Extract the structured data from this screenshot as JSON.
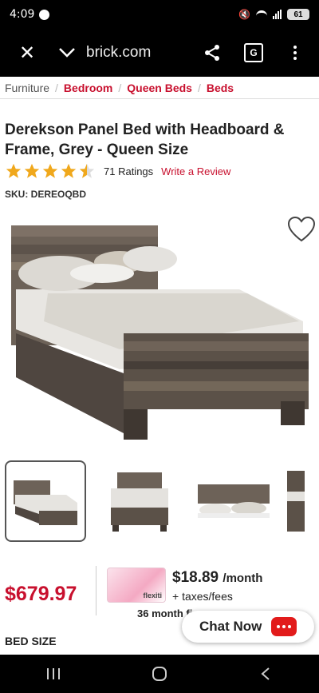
{
  "status_bar": {
    "time": "4:09",
    "battery": "61"
  },
  "browser": {
    "url": "brick.com",
    "icons": [
      "close-icon",
      "chevron-down-icon",
      "share-icon",
      "translate-icon",
      "more-options-icon"
    ]
  },
  "breadcrumb": {
    "home": "Furniture",
    "items": [
      "Bedroom",
      "Queen Beds",
      "Beds"
    ]
  },
  "product": {
    "title": "Derekson Panel Bed with Headboard & Frame, Grey - Queen Size",
    "rating": 4.5,
    "ratings_count": "71 Ratings",
    "write_review": "Write a Review",
    "sku": "SKU: DEREOQBD"
  },
  "price": {
    "amount": "$679.97",
    "monthly": "$18.89",
    "monthly_suffix": "/month",
    "taxes": "+ taxes/fees",
    "months": "36 month fi"
  },
  "flexiti": {
    "brand": "flexiti"
  },
  "chat": {
    "label": "Chat Now"
  },
  "section": {
    "bed_size": "BED SIZE"
  },
  "colors": {
    "accent": "#c8102e",
    "star": "#f0a81c",
    "chat_icon": "#e21b1b"
  }
}
